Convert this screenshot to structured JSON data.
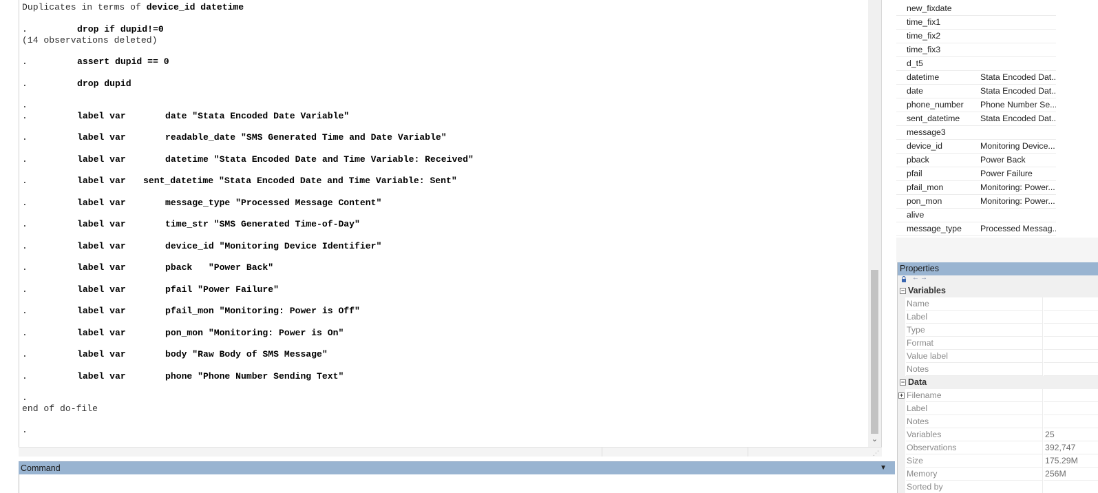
{
  "results": {
    "dup_prefix": "Duplicates in terms of ",
    "dup_vars": "device_id datetime",
    "lines": [
      {
        "dot": ".",
        "cmd": "drop if dupid!=0"
      },
      {
        "plain": "(14 observations deleted)"
      },
      {
        "dot": ".",
        "cmd": "assert dupid == 0"
      },
      {
        "dot": ".",
        "cmd": "drop dupid"
      },
      {
        "dot": "."
      },
      {
        "dot": ".",
        "cmd": "label var",
        "arg": "date \"Stata Encoded Date Variable\""
      },
      {
        "dot": ".",
        "cmd": "label var",
        "arg": "readable_date \"SMS Generated Time and Date Variable\""
      },
      {
        "dot": ".",
        "cmd": "label var",
        "arg": "datetime \"Stata Encoded Date and Time Variable: Received\""
      },
      {
        "dot": ".",
        "cmd": "label var",
        "arg": "sent_datetime \"Stata Encoded Date and Time Variable: Sent\""
      },
      {
        "dot": ".",
        "cmd": "label var",
        "arg": "message_type \"Processed Message Content\""
      },
      {
        "dot": ".",
        "cmd": "label var",
        "arg": "time_str \"SMS Generated Time-of-Day\""
      },
      {
        "dot": ".",
        "cmd": "label var",
        "arg": "device_id \"Monitoring Device Identifier\""
      },
      {
        "dot": ".",
        "cmd": "label var",
        "arg": "pback   \"Power Back\""
      },
      {
        "dot": ".",
        "cmd": "label var",
        "arg": "pfail \"Power Failure\""
      },
      {
        "dot": ".",
        "cmd": "label var",
        "arg": "pfail_mon \"Monitoring: Power is Off\""
      },
      {
        "dot": ".",
        "cmd": "label var",
        "arg": "pon_mon \"Monitoring: Power is On\""
      },
      {
        "dot": ".",
        "cmd": "label var",
        "arg": "body \"Raw Body of SMS Message\""
      },
      {
        "dot": ".",
        "cmd": "label var",
        "arg": "phone \"Phone Number Sending Text\""
      },
      {
        "dot": "."
      },
      {
        "plain": "end of do-file"
      },
      {
        "dot": "."
      }
    ]
  },
  "command": {
    "title": "Command",
    "value": ""
  },
  "variables": [
    {
      "name": "new_fixdate",
      "label": ""
    },
    {
      "name": "time_fix1",
      "label": ""
    },
    {
      "name": "time_fix2",
      "label": ""
    },
    {
      "name": "time_fix3",
      "label": ""
    },
    {
      "name": "d_t5",
      "label": ""
    },
    {
      "name": "datetime",
      "label": "Stata Encoded Dat..."
    },
    {
      "name": "date",
      "label": "Stata Encoded Dat..."
    },
    {
      "name": "phone_number",
      "label": "Phone Number Se..."
    },
    {
      "name": "sent_datetime",
      "label": "Stata Encoded Dat..."
    },
    {
      "name": "message3",
      "label": ""
    },
    {
      "name": "device_id",
      "label": "Monitoring Device..."
    },
    {
      "name": "pback",
      "label": "Power Back"
    },
    {
      "name": "pfail",
      "label": "Power Failure"
    },
    {
      "name": "pfail_mon",
      "label": "Monitoring: Power..."
    },
    {
      "name": "pon_mon",
      "label": "Monitoring: Power..."
    },
    {
      "name": "alive",
      "label": ""
    },
    {
      "name": "message_type",
      "label": "Processed Messag..."
    }
  ],
  "properties": {
    "title": "Properties",
    "variables_section": "Variables",
    "variables_rows": [
      {
        "key": "Name",
        "value": ""
      },
      {
        "key": "Label",
        "value": ""
      },
      {
        "key": "Type",
        "value": ""
      },
      {
        "key": "Format",
        "value": ""
      },
      {
        "key": "Value label",
        "value": ""
      },
      {
        "key": "Notes",
        "value": ""
      }
    ],
    "data_section": "Data",
    "data_rows": [
      {
        "key": "Filename",
        "value": ""
      },
      {
        "key": "Label",
        "value": ""
      },
      {
        "key": "Notes",
        "value": ""
      },
      {
        "key": "Variables",
        "value": "25"
      },
      {
        "key": "Observations",
        "value": "392,747"
      },
      {
        "key": "Size",
        "value": "175.29M"
      },
      {
        "key": "Memory",
        "value": "256M"
      },
      {
        "key": "Sorted by",
        "value": ""
      }
    ]
  },
  "colors": {
    "pane_header": "#99b4d1",
    "background": "#ffffff"
  }
}
